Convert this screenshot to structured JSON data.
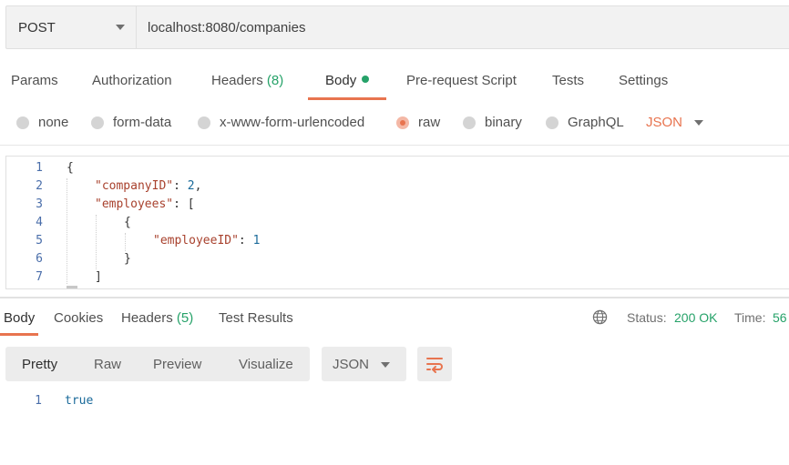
{
  "request": {
    "method": "POST",
    "url": "localhost:8080/companies"
  },
  "request_tabs": [
    {
      "label": "Params"
    },
    {
      "label": "Authorization"
    },
    {
      "label": "Headers",
      "count": "(8)"
    },
    {
      "label": "Body",
      "active": true
    },
    {
      "label": "Pre-request Script"
    },
    {
      "label": "Tests"
    },
    {
      "label": "Settings"
    }
  ],
  "body_types": [
    "none",
    "form-data",
    "x-www-form-urlencoded",
    "raw",
    "binary",
    "GraphQL"
  ],
  "body_type_selected": "raw",
  "body_format": "JSON",
  "editor": {
    "line_numbers": [
      "1",
      "2",
      "3",
      "4",
      "5",
      "6",
      "7"
    ],
    "lines": {
      "l1": "{",
      "l2_key": "\"companyID\"",
      "l2_rest": ": ",
      "l2_val": "2",
      "l2_end": ",",
      "l3_key": "\"employees\"",
      "l3_rest": ": [",
      "l4": "{",
      "l5_key": "\"employeeID\"",
      "l5_rest": ": ",
      "l5_val": "1",
      "l6": "}",
      "l7": "]"
    }
  },
  "response_tabs": [
    {
      "label": "Body",
      "active": true
    },
    {
      "label": "Cookies"
    },
    {
      "label": "Headers",
      "count": "(5)"
    },
    {
      "label": "Test Results"
    }
  ],
  "status": {
    "label": "Status:",
    "value": "200 OK",
    "time_label": "Time:",
    "time_value": "56"
  },
  "view_modes": [
    "Pretty",
    "Raw",
    "Preview",
    "Visualize"
  ],
  "view_mode_selected": "Pretty",
  "response_format": "JSON",
  "response_body": {
    "line_number": "1",
    "content": "true"
  },
  "colors": {
    "accent": "#e8744f",
    "success": "#26a269"
  }
}
